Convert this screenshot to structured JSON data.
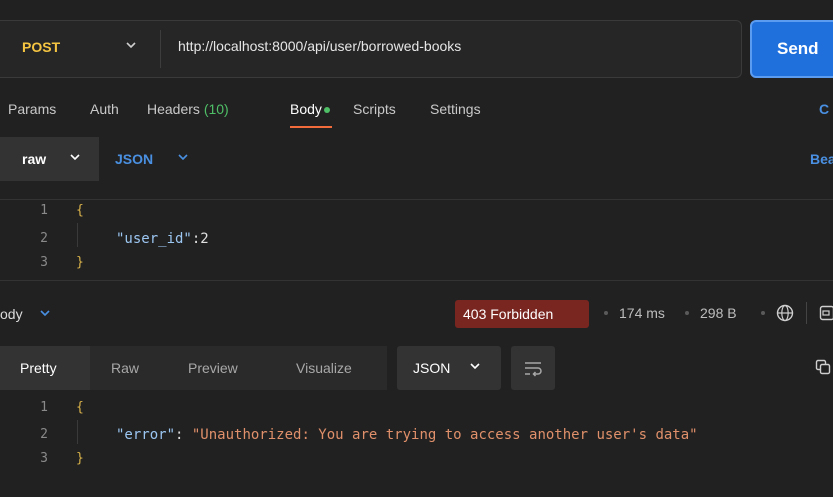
{
  "request": {
    "method": "POST",
    "url": "http://localhost:8000/api/user/borrowed-books",
    "send_label": "Send",
    "tabs": {
      "params": "Params",
      "auth": "Auth",
      "headers": "Headers",
      "headers_count": "(10)",
      "body": "Body",
      "scripts": "Scripts",
      "settings": "Settings",
      "cookies": "C"
    },
    "body_mode": "raw",
    "body_format": "JSON",
    "beautify": "Bea",
    "editor": {
      "lines": [
        "1",
        "2",
        "3"
      ],
      "open": "{",
      "close": "}",
      "key": "\"user_id\"",
      "colon": ":",
      "value": "2"
    }
  },
  "response": {
    "body_label": "ody",
    "status": "403 Forbidden",
    "time": "174 ms",
    "size": "298 B",
    "views": {
      "pretty": "Pretty",
      "raw": "Raw",
      "preview": "Preview",
      "visualize": "Visualize"
    },
    "format": "JSON",
    "editor": {
      "lines": [
        "1",
        "2",
        "3"
      ],
      "open": "{",
      "close": "}",
      "key": "\"error\"",
      "colon": ": ",
      "value": "\"Unauthorized: You are trying to access another user's data\""
    }
  },
  "colors": {
    "method": "#f5c542",
    "send": "#1f6fdc",
    "accent_link": "#4a90e2",
    "active_tab_underline": "#f26b3a",
    "status_error": "#7a2620",
    "headers_count": "#4fbf67"
  },
  "icons": [
    "chevron-down-icon",
    "globe-icon",
    "save-icon",
    "wrap-lines-icon",
    "copy-icon"
  ]
}
